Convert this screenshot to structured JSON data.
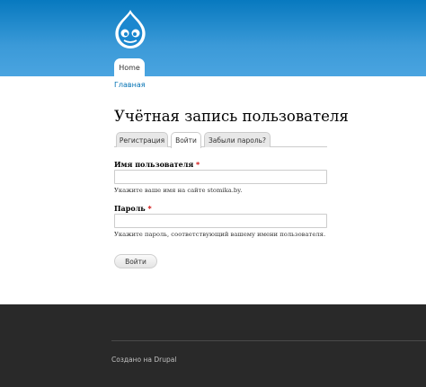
{
  "header": {
    "logo_icon": "drupal-drop-icon",
    "nav": {
      "home_label": "Home"
    }
  },
  "breadcrumb": {
    "home_label": "Главная"
  },
  "page": {
    "title": "Учётная запись пользователя"
  },
  "tabs": [
    {
      "label": "Регистрация",
      "active": false
    },
    {
      "label": "Войти",
      "active": true
    },
    {
      "label": "Забыли пароль?",
      "active": false
    }
  ],
  "form": {
    "username": {
      "label": "Имя пользователя",
      "required_mark": "*",
      "value": "",
      "description": "Укажите ваше имя на сайте stomika.by."
    },
    "password": {
      "label": "Пароль",
      "required_mark": "*",
      "value": "",
      "description": "Укажите пароль, соответствующий вашему имени пользователя."
    },
    "submit_label": "Войти"
  },
  "footer": {
    "credit": "Создано на Drupal"
  },
  "colors": {
    "header_blue": "#0779bf",
    "link_blue": "#0071b3",
    "required_red": "#cc0000",
    "footer_bg": "#292929"
  }
}
